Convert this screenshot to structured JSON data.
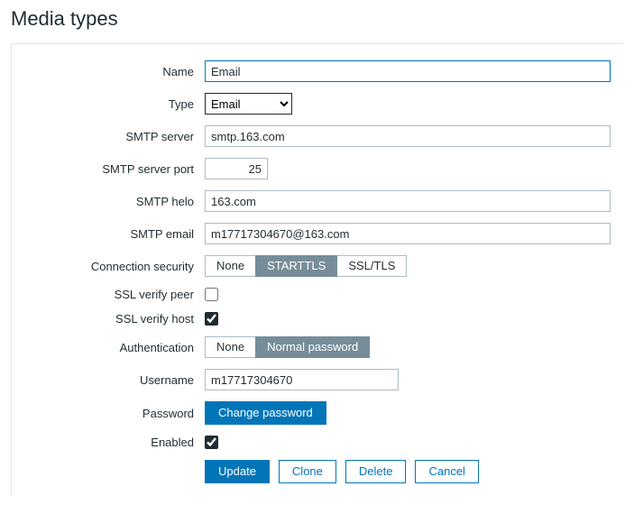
{
  "page": {
    "title": "Media types"
  },
  "labels": {
    "name": "Name",
    "type": "Type",
    "smtp_server": "SMTP server",
    "smtp_port": "SMTP server port",
    "smtp_helo": "SMTP helo",
    "smtp_email": "SMTP email",
    "conn_sec": "Connection security",
    "ssl_peer": "SSL verify peer",
    "ssl_host": "SSL verify host",
    "auth": "Authentication",
    "username": "Username",
    "password": "Password",
    "enabled": "Enabled"
  },
  "values": {
    "name": "Email",
    "type": "Email",
    "smtp_server": "smtp.163.com",
    "smtp_port": "25",
    "smtp_helo": "163.com",
    "smtp_email": "m17717304670@163.com",
    "username": "m17717304670"
  },
  "conn_sec": {
    "none": "None",
    "starttls": "STARTTLS",
    "ssltls": "SSL/TLS"
  },
  "auth": {
    "none": "None",
    "normal": "Normal password"
  },
  "buttons": {
    "change_password": "Change password",
    "update": "Update",
    "clone": "Clone",
    "delete": "Delete",
    "cancel": "Cancel"
  }
}
